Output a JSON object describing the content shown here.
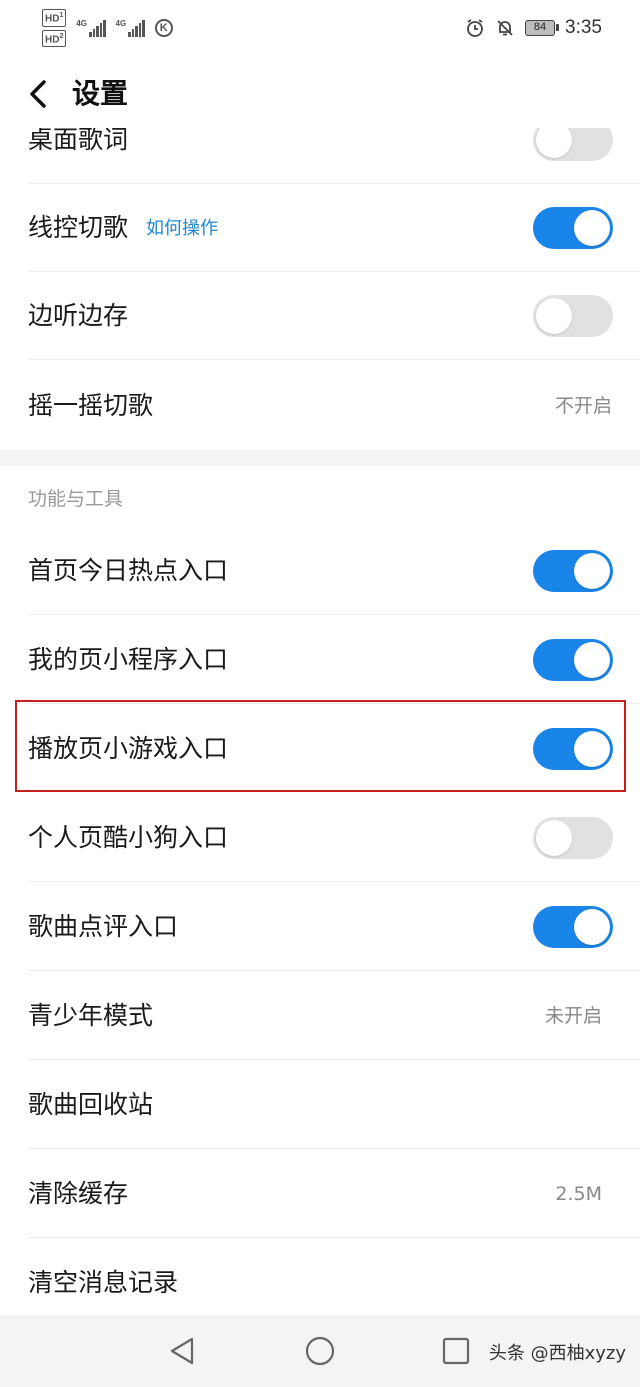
{
  "status_bar": {
    "hd1": "HD",
    "hd1_sub": "1",
    "hd2": "HD",
    "hd2_sub": "2",
    "network1": "4G",
    "network2": "4G",
    "k_icon": "K",
    "battery": "84",
    "time": "3:35"
  },
  "header": {
    "title": "设置",
    "back_icon": "chevron-left-icon"
  },
  "list": {
    "desktop_lyrics": {
      "label": "桌面歌词",
      "toggle_on": false
    },
    "wire_control": {
      "label": "线控切歌",
      "link": "如何操作",
      "toggle_on": true
    },
    "listen_save": {
      "label": "边听边存",
      "toggle_on": false
    },
    "shake_switch": {
      "label": "摇一摇切歌",
      "value": "不开启"
    }
  },
  "section": {
    "title": "功能与工具",
    "items": {
      "home_hot": {
        "label": "首页今日热点入口",
        "toggle_on": true
      },
      "mine_miniprogram": {
        "label": "我的页小程序入口",
        "toggle_on": true
      },
      "player_minigame": {
        "label": "播放页小游戏入口",
        "toggle_on": true
      },
      "profile_kugou": {
        "label": "个人页酷小狗入口",
        "toggle_on": false
      },
      "song_review": {
        "label": "歌曲点评入口",
        "toggle_on": true
      },
      "teen_mode": {
        "label": "青少年模式",
        "value": "未开启"
      },
      "recycle_bin": {
        "label": "歌曲回收站"
      },
      "clear_cache": {
        "label": "清除缓存",
        "value": "2.5M"
      },
      "clear_messages": {
        "label": "清空消息记录"
      }
    }
  },
  "nav_bar": {
    "back": "triangle-back-icon",
    "home": "circle-home-icon",
    "recents": "square-recents-icon",
    "watermark": "头条 @西柚xyzy"
  },
  "colors": {
    "accent": "#1a85e8",
    "link": "#1e88d6",
    "toggle_off": "#e1e1e1",
    "highlight_border": "#c91e1e"
  }
}
